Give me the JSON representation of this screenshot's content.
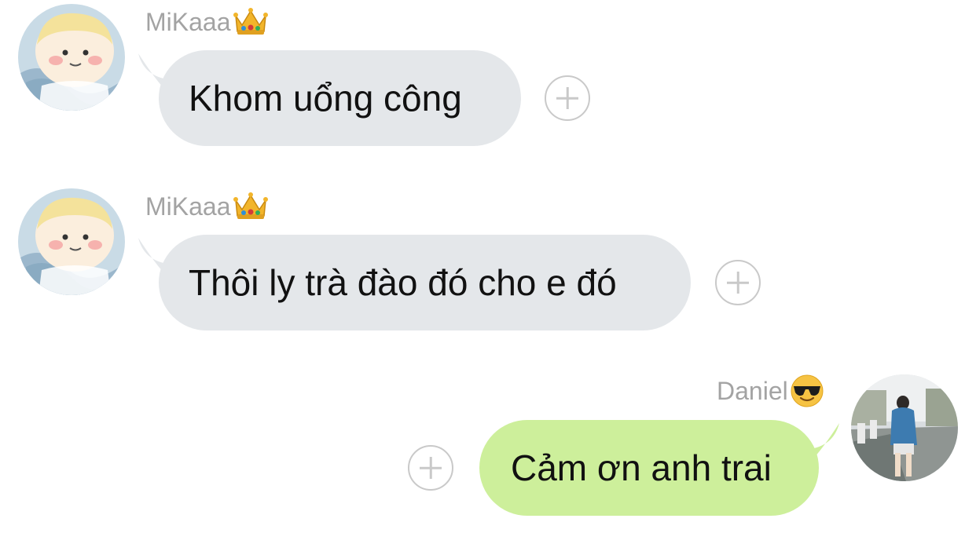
{
  "messages": [
    {
      "sender": "MiKaaa",
      "sender_emoji": "crown-emoji",
      "text": "Khom uổng công",
      "direction": "incoming"
    },
    {
      "sender": "MiKaaa",
      "sender_emoji": "crown-emoji",
      "text": "Thôi ly trà đào đó cho e đó",
      "direction": "incoming"
    },
    {
      "sender": "Daniel",
      "sender_emoji": "sunglasses-face-emoji",
      "text": "Cảm ơn anh trai",
      "direction": "outgoing"
    }
  ],
  "colors": {
    "incoming_bubble": "#e4e7ea",
    "outgoing_bubble": "#cdef9b",
    "sender_name": "#a3a3a3",
    "react_button": "#c9c9c9"
  },
  "icons": {
    "react_button": "add-reaction-icon"
  }
}
